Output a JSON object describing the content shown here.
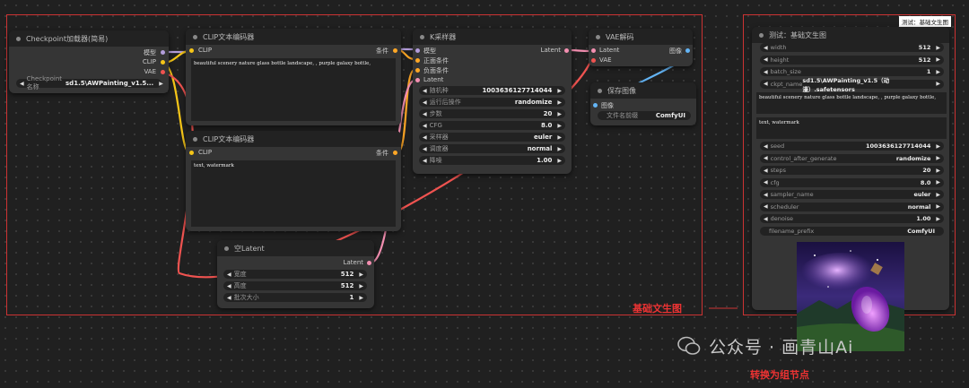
{
  "checkpoint": {
    "title": "Checkpoint加载器(简易)",
    "out_model": "模型",
    "out_clip": "CLIP",
    "out_vae": "VAE",
    "ckpt_label": "Checkpoint名称",
    "ckpt_value": "sd1.5\\AWPainting_v1.5..."
  },
  "clip1": {
    "title": "CLIP文本编码器",
    "in_clip": "CLIP",
    "out_cond": "条件",
    "text": "beautiful scenery nature glass bottle landscape, , purple galaxy bottle,"
  },
  "clip2": {
    "title": "CLIP文本编码器",
    "in_clip": "CLIP",
    "out_cond": "条件",
    "text": "text, watermark"
  },
  "latent": {
    "title": "空Latent",
    "out": "Latent",
    "widgets": [
      {
        "label": "宽度",
        "value": "512"
      },
      {
        "label": "高度",
        "value": "512"
      },
      {
        "label": "批次大小",
        "value": "1"
      }
    ]
  },
  "ksampler": {
    "title": "K采样器",
    "in_model": "模型",
    "in_pos": "正面条件",
    "in_neg": "负面条件",
    "in_latent": "Latent",
    "out": "Latent",
    "widgets": [
      {
        "label": "随机种",
        "value": "1003636127714044"
      },
      {
        "label": "运行后操作",
        "value": "randomize"
      },
      {
        "label": "步数",
        "value": "20"
      },
      {
        "label": "CFG",
        "value": "8.0"
      },
      {
        "label": "采样器",
        "value": "euler"
      },
      {
        "label": "调度器",
        "value": "normal"
      },
      {
        "label": "降噪",
        "value": "1.00"
      }
    ]
  },
  "vae": {
    "title": "VAE解码",
    "in_latent": "Latent",
    "in_vae": "VAE",
    "out": "图像"
  },
  "save": {
    "title": "保存图像",
    "in": "图像",
    "prefix_label": "文件名前缀",
    "prefix_value": "ComfyUI"
  },
  "group_label_left": "基础文生图",
  "group_node": {
    "tag": "测试：基础文生图",
    "title": "测试：基础文生图",
    "widgets_top": [
      {
        "label": "width",
        "value": "512"
      },
      {
        "label": "height",
        "value": "512"
      },
      {
        "label": "batch_size",
        "value": "1"
      },
      {
        "label": "ckpt_name",
        "value": "sd1.5\\AWPainting_v1.5（动漫）.safetensors"
      }
    ],
    "text1": "beautiful scenery nature glass bottle landscape, , purple galaxy bottle,",
    "text2": "text, watermark",
    "widgets_bottom": [
      {
        "label": "seed",
        "value": "1003636127714044"
      },
      {
        "label": "control_after_generate",
        "value": "randomize"
      },
      {
        "label": "steps",
        "value": "20"
      },
      {
        "label": "cfg",
        "value": "8.0"
      },
      {
        "label": "sampler_name",
        "value": "euler"
      },
      {
        "label": "scheduler",
        "value": "normal"
      },
      {
        "label": "denoise",
        "value": "1.00"
      },
      {
        "label": "filename_prefix",
        "value": "ComfyUI"
      }
    ]
  },
  "caption_convert": "转换为组节点",
  "watermark": "公众号 · 画青山Ai",
  "colors": {
    "clip": "#f5c518",
    "model": "#b39ddb",
    "latent": "#f48fb1",
    "vae": "#ef5350",
    "cond": "#ffa726",
    "image": "#64b5f6"
  }
}
